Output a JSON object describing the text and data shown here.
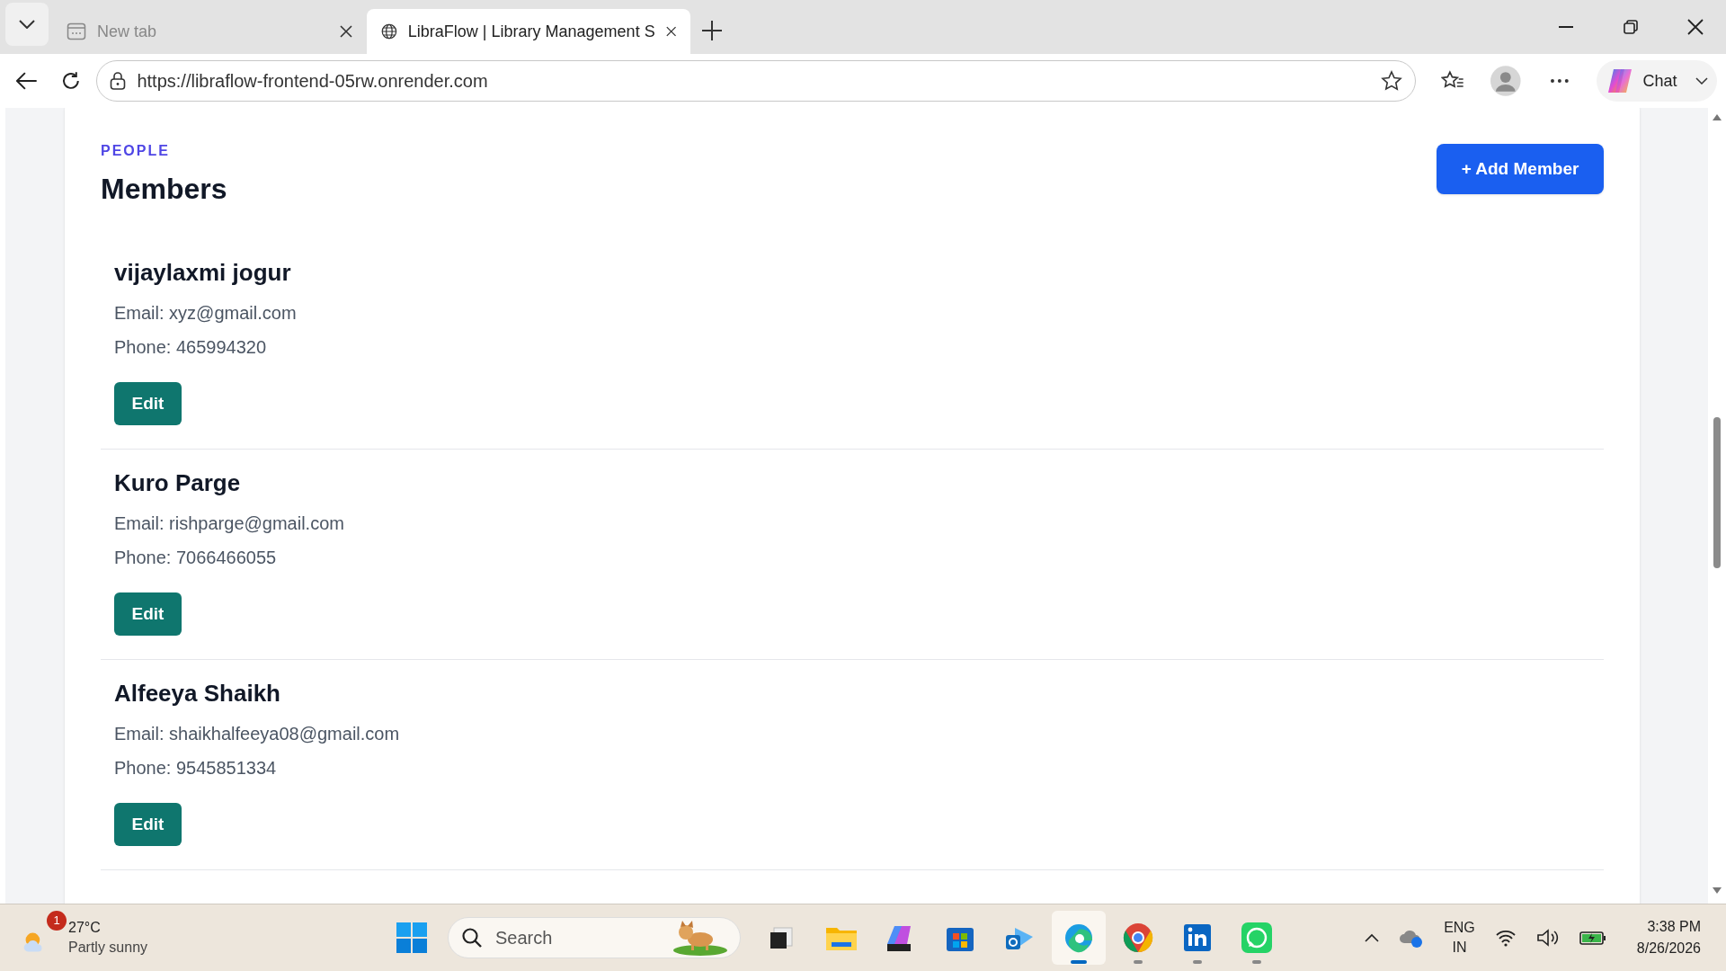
{
  "browser": {
    "tabs": [
      {
        "title": "New tab",
        "selected": false
      },
      {
        "title": "LibraFlow | Library Management S",
        "selected": true
      }
    ],
    "url": "https://libraflow-frontend-05rw.onrender.com",
    "chat_label": "Chat"
  },
  "page": {
    "eyebrow": "PEOPLE",
    "title": "Members",
    "add_button": "+ Add Member",
    "members": [
      {
        "name": "vijaylaxmi jogur",
        "email": "Email: xyz@gmail.com",
        "phone": "Phone: 465994320",
        "action": "Edit"
      },
      {
        "name": "Kuro Parge",
        "email": "Email: rishparge@gmail.com",
        "phone": "Phone: 7066466055",
        "action": "Edit"
      },
      {
        "name": "Alfeeya Shaikh",
        "email": "Email: shaikhalfeeya08@gmail.com",
        "phone": "Phone: 9545851334",
        "action": "Edit"
      }
    ]
  },
  "taskbar": {
    "weather_badge": "1",
    "temperature": "27°C",
    "weather": "Partly sunny",
    "search_placeholder": "Search",
    "language": "ENG",
    "region": "IN",
    "time": "3:38 PM",
    "date": "8/26/2026",
    "apps": [
      {
        "running": false,
        "selected": false
      },
      {
        "running": false,
        "selected": false
      },
      {
        "running": false,
        "selected": false
      },
      {
        "running": false,
        "selected": false
      },
      {
        "running": false,
        "selected": false
      },
      {
        "running": true,
        "selected": true
      },
      {
        "running": true,
        "selected": false
      },
      {
        "running": true,
        "selected": false
      },
      {
        "running": true,
        "selected": false
      }
    ]
  }
}
